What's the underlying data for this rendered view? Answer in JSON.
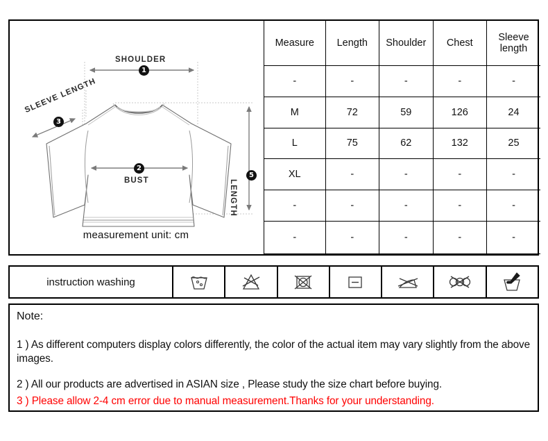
{
  "diagram": {
    "labels": {
      "shoulder": "SHOULDER",
      "bust": "BUST",
      "sleeve_length": "SLEEVE LENGTH",
      "length": "LENGTH"
    },
    "markers": {
      "shoulder": "1",
      "bust": "2",
      "sleeve": "3",
      "length": "5"
    },
    "unit_note": "measurement unit: cm"
  },
  "size_table": {
    "headers": [
      "Measure",
      "Length",
      "Shoulder",
      "Chest",
      "Sleeve length"
    ],
    "rows": [
      {
        "cells": [
          "-",
          "-",
          "-",
          "-",
          "-"
        ],
        "faint": false
      },
      {
        "cells": [
          "M",
          "72",
          "59",
          "126",
          "24"
        ],
        "faint": false
      },
      {
        "cells": [
          "L",
          "75",
          "62",
          "132",
          "25"
        ],
        "faint": false
      },
      {
        "cells": [
          "XL",
          "-",
          "-",
          "-",
          "-"
        ],
        "faint": false
      },
      {
        "cells": [
          "-",
          "-",
          "-",
          "-",
          "-"
        ],
        "faint": false
      },
      {
        "cells": [
          "-",
          "-",
          "-",
          "-",
          "-"
        ],
        "faint": true
      }
    ]
  },
  "washing": {
    "title": "instruction washing",
    "icons": [
      "machine-wash-icon",
      "do-not-bleach-icon",
      "do-not-tumble-dry-icon",
      "dry-flat-icon",
      "do-not-iron-icon",
      "do-not-dry-clean-icon",
      "hand-wash-icon"
    ]
  },
  "note": {
    "heading": "Note:",
    "line1": "1 ) As different computers display colors differently, the color of the actual item may vary slightly from the above images.",
    "line2": "2 ) All our products are advertised in ASIAN size , Please study the size chart before buying.",
    "line3": "3 ) Please allow 2-4 cm error due to manual measurement.Thanks for your understanding.",
    "line3_color": "#ff0000"
  }
}
